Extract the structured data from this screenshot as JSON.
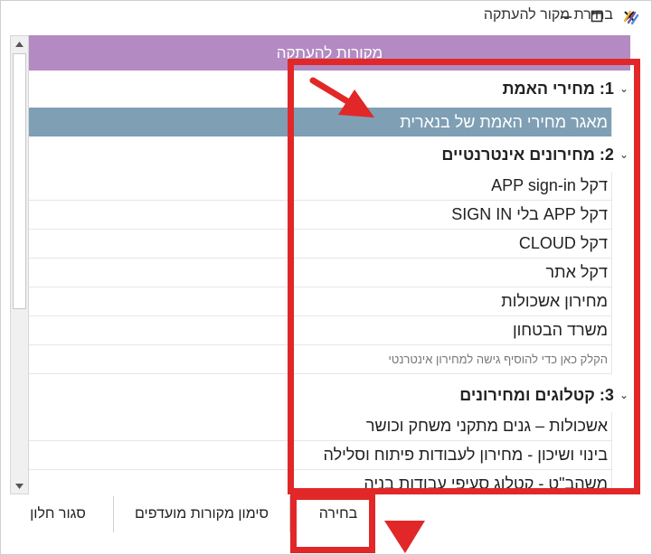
{
  "window": {
    "title": "בחירת מקור להעתקה",
    "controls": {
      "close": "✕",
      "maximize": "☐",
      "minimize": "—"
    }
  },
  "panel": {
    "header": "מקורות להעתקה",
    "groups": [
      {
        "label": "1: מחירי האמת",
        "items": [
          {
            "label": "מאגר מחירי האמת של בנארית",
            "selected": true
          }
        ]
      },
      {
        "label": "2: מחירונים אינטרנטיים",
        "items": [
          {
            "label": "דקל APP sign-in"
          },
          {
            "label": "דקל APP בלי SIGN IN"
          },
          {
            "label": "דקל CLOUD"
          },
          {
            "label": "דקל אתר"
          },
          {
            "label": "מחירון אשכולות"
          },
          {
            "label": "משרד הבטחון"
          },
          {
            "label": "הקלק כאן כדי להוסיף גישה למחירון אינטרנטי",
            "hint": true
          }
        ]
      },
      {
        "label": "3: קטלוגים ומחירונים",
        "items": [
          {
            "label": "אשכולות – גנים מתקני משחק וכושר"
          },
          {
            "label": "בינוי ושיכון - מחירון לעבודות פיתוח וסלילה"
          },
          {
            "label": "משהב\"ט - קטלוג סעיפי עבודות בניה"
          }
        ]
      }
    ]
  },
  "footer": {
    "select_label": "בחירה",
    "favorites_label": "סימון מקורות מועדפים",
    "close_label": "סגור חלון"
  },
  "colors": {
    "header_bg": "#b38ac2",
    "selected_bg": "#7f9fb5",
    "annotation_red": "#e12727"
  },
  "icons": {
    "app": "app-logo-icon",
    "chevron": "chevron-down-icon",
    "scroll_up": "scroll-up-arrow-icon",
    "scroll_down": "scroll-down-arrow-icon"
  }
}
